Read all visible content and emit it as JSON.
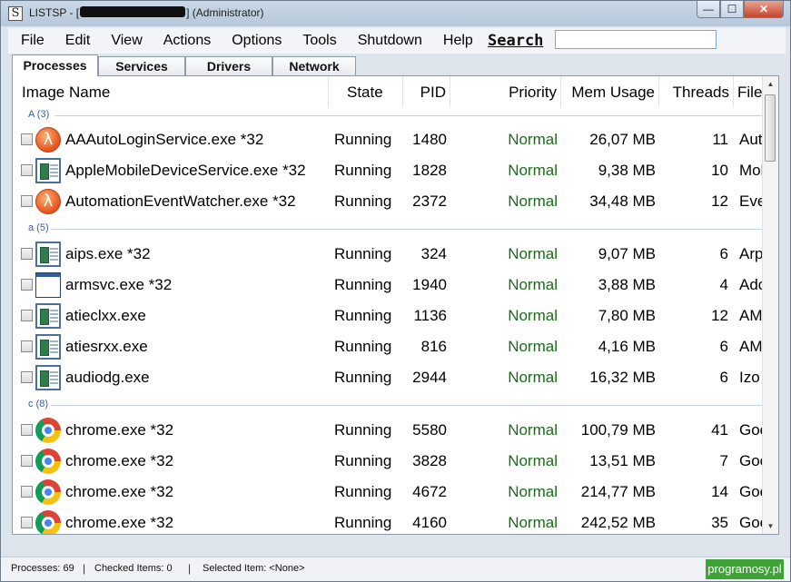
{
  "window": {
    "title_prefix": "LISTSP - [",
    "title_suffix": "] (Administrator)",
    "app_icon": "S",
    "controls": {
      "minimize": "—",
      "maximize": "☐",
      "close": "✕"
    }
  },
  "menu": {
    "items": [
      "File",
      "Edit",
      "View",
      "Actions",
      "Options",
      "Tools",
      "Shutdown",
      "Help"
    ],
    "search_label": "Search",
    "search_value": ""
  },
  "tabs": [
    {
      "label": "Processes",
      "active": true
    },
    {
      "label": "Services",
      "active": false
    },
    {
      "label": "Drivers",
      "active": false
    },
    {
      "label": "Network",
      "active": false
    }
  ],
  "columns": {
    "image_name": "Image Name",
    "state": "State",
    "pid": "PID",
    "priority": "Priority",
    "mem_usage": "Mem Usage",
    "threads": "Threads",
    "file": "File"
  },
  "groups": [
    {
      "label": "A (3)",
      "rows": [
        {
          "icon": "adobe-icon",
          "name": "AAAutoLoginService.exe *32",
          "state": "Running",
          "pid": "1480",
          "priority": "Normal",
          "mem": "26,07 MB",
          "threads": "11",
          "file": "Auto"
        },
        {
          "icon": "exe-icon",
          "name": "AppleMobileDeviceService.exe *32",
          "state": "Running",
          "pid": "1828",
          "priority": "Normal",
          "mem": "9,38 MB",
          "threads": "10",
          "file": "Mob"
        },
        {
          "icon": "adobe-icon",
          "name": "AutomationEventWatcher.exe *32",
          "state": "Running",
          "pid": "2372",
          "priority": "Normal",
          "mem": "34,48 MB",
          "threads": "12",
          "file": "Eve"
        }
      ]
    },
    {
      "label": "a (5)",
      "rows": [
        {
          "icon": "exe-icon",
          "name": "aips.exe *32",
          "state": "Running",
          "pid": "324",
          "priority": "Normal",
          "mem": "9,07 MB",
          "threads": "6",
          "file": "Arp"
        },
        {
          "icon": "window-icon",
          "name": "armsvc.exe *32",
          "state": "Running",
          "pid": "1940",
          "priority": "Normal",
          "mem": "3,88 MB",
          "threads": "4",
          "file": "Ado"
        },
        {
          "icon": "exe-icon",
          "name": "atieclxx.exe",
          "state": "Running",
          "pid": "1136",
          "priority": "Normal",
          "mem": "7,80 MB",
          "threads": "12",
          "file": "AMD"
        },
        {
          "icon": "exe-icon",
          "name": "atiesrxx.exe",
          "state": "Running",
          "pid": "816",
          "priority": "Normal",
          "mem": "4,16 MB",
          "threads": "6",
          "file": "AMD"
        },
        {
          "icon": "exe-icon",
          "name": "audiodg.exe",
          "state": "Running",
          "pid": "2944",
          "priority": "Normal",
          "mem": "16,32 MB",
          "threads": "6",
          "file": "Izo"
        }
      ]
    },
    {
      "label": "c (8)",
      "rows": [
        {
          "icon": "chrome-icon",
          "name": "chrome.exe *32",
          "state": "Running",
          "pid": "5580",
          "priority": "Normal",
          "mem": "100,79 MB",
          "threads": "41",
          "file": "Goo"
        },
        {
          "icon": "chrome-icon",
          "name": "chrome.exe *32",
          "state": "Running",
          "pid": "3828",
          "priority": "Normal",
          "mem": "13,51 MB",
          "threads": "7",
          "file": "Goo"
        },
        {
          "icon": "chrome-icon",
          "name": "chrome.exe *32",
          "state": "Running",
          "pid": "4672",
          "priority": "Normal",
          "mem": "214,77 MB",
          "threads": "14",
          "file": "Goo"
        },
        {
          "icon": "chrome-icon",
          "name": "chrome.exe *32",
          "state": "Running",
          "pid": "4160",
          "priority": "Normal",
          "mem": "242,52 MB",
          "threads": "35",
          "file": "Goo"
        }
      ]
    }
  ],
  "status": {
    "processes": "Processes: 69",
    "checked": "Checked Items: 0",
    "selected": "Selected Item: <None>",
    "separator": "|"
  },
  "watermark": "programosy.pl"
}
